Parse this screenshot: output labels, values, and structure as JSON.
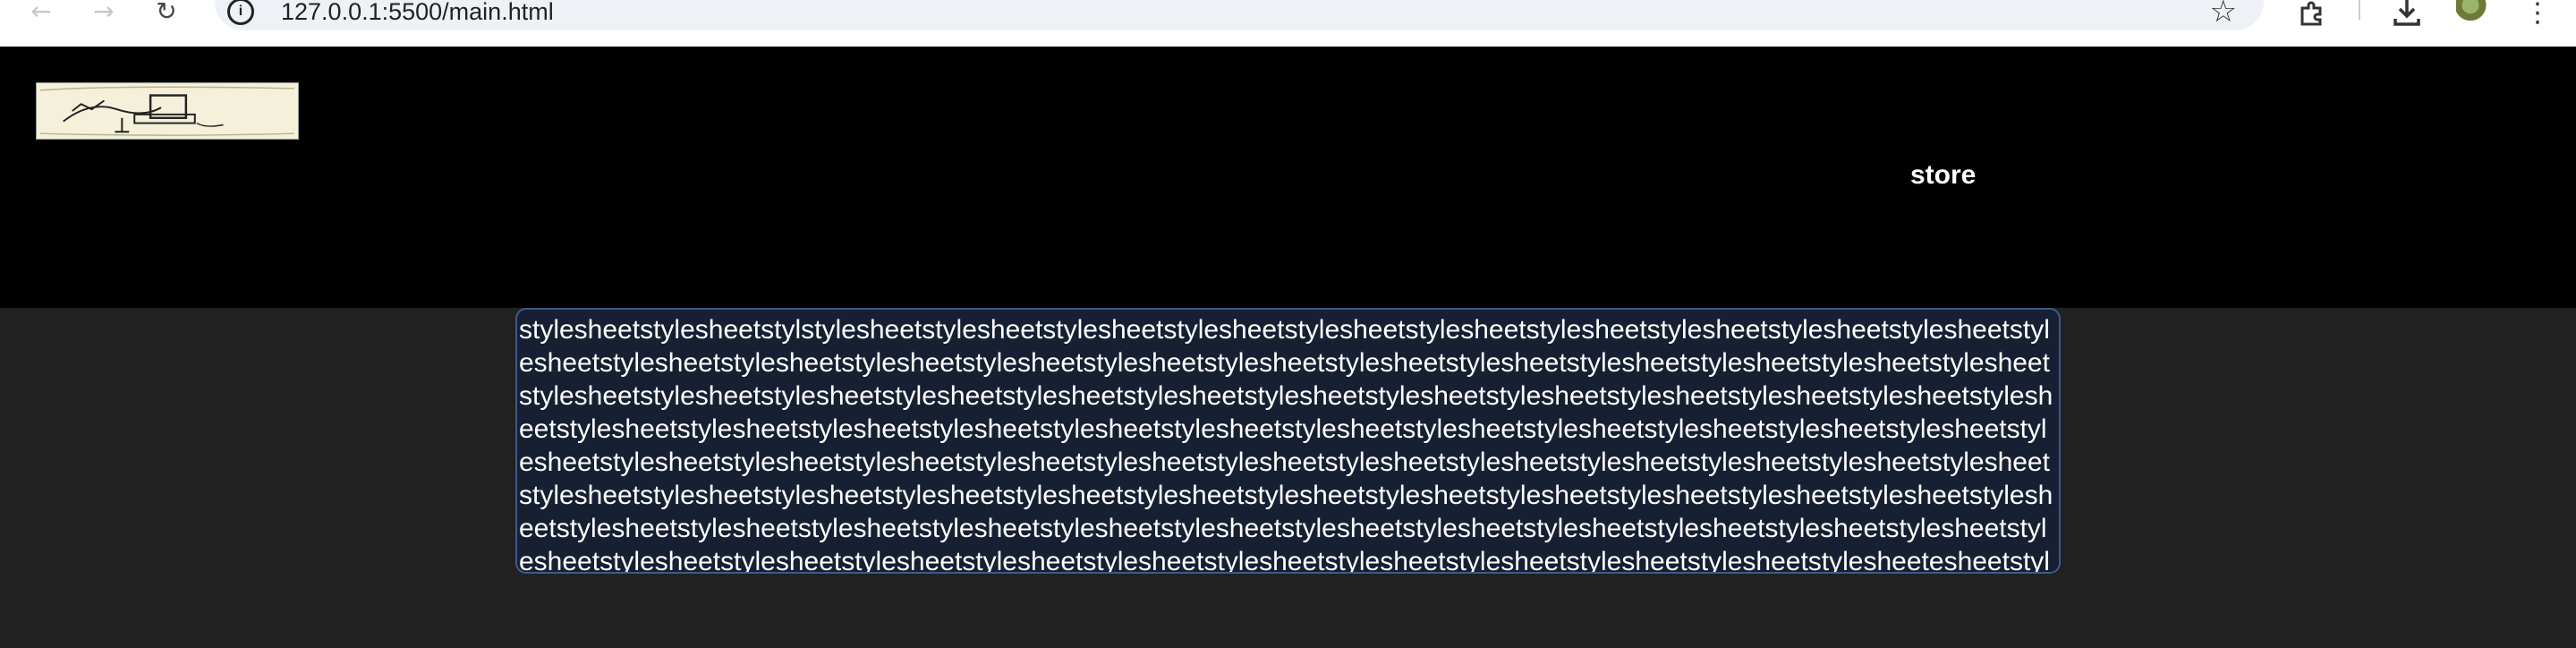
{
  "browser": {
    "url": "127.0.0.1:5500/main.html",
    "icons": {
      "back": "arrow-left-icon",
      "forward": "arrow-right-icon",
      "reload": "reload-icon",
      "site_info": "info-icon",
      "bookmark": "star-icon",
      "extensions": "puzzle-icon",
      "downloads": "download-icon",
      "profile": "avatar-icon",
      "menu": "kebab-menu-icon"
    }
  },
  "header": {
    "logo_alt": "sketch logo",
    "nav": {
      "store_label": "store"
    }
  },
  "main": {
    "content_text": "stylesheetstylesheetstylstylesheetstylesheetstylesheetstylesheetstylesheetstylesheetstylesheetstylesheetstylesheetstylesheetstylesheetstylesheetstylesheetstylesheetstylesheetstylesheetstylesheetstylesheetstylesheetstylesheetstylesheetstylesheetstylesheetstylesheetstylesheetstylesheetstylesheetstylesheetstylesheetstylesheetstylesheetstylesheetstylesheetstylesheetstylesheetstylesheetstylesheetstylesheetstylesheetstylesheetstylesheetstylesheetstylesheetstylesheetstylesheetstylesheetstylesheetstylesheetstylesheetstylesheetstylesheetstylesheetstylesheetstylesheetstylesheetstylesheetstylesheetstylesheetstylesheetstylesheetstylesheetstylesheetstylesheetstylesheetstylesheetstylesheetstylesheetstylesheetstylesheetstylesheetstylesheetstylesheetstylesheetstylesheetstylesheetstylesheetstylesheetstylesheetstylesheetstylesheetstylesheetstylesheetstylesheetstylesheetstylesheetstylesheetstylesheetstylesheetstylesheetstylesheetstylesheetstylesheetstylesheetstylesheetstylesheetstylesheetstylesheetstylesheetesheetstylesheetstylesheetstylesheetstylesheetstylesheetstylesheetstylesheet"
  },
  "colors": {
    "header_bg": "#000000",
    "page_bg": "#212121",
    "box_bg": "#172033",
    "box_border": "#3b5b8f",
    "text": "#ffffff"
  }
}
